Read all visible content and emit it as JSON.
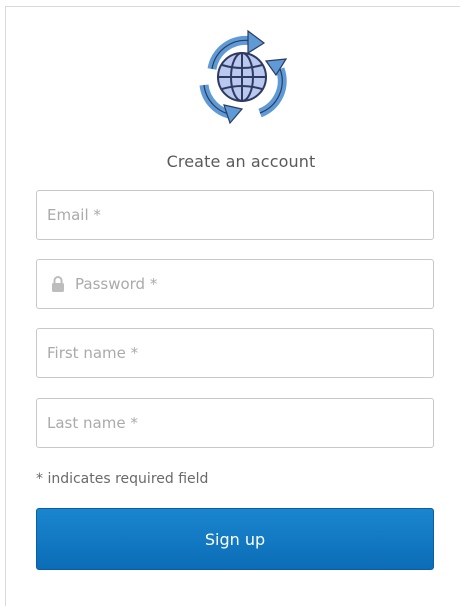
{
  "form": {
    "title": "Create an account",
    "fields": [
      {
        "name": "email",
        "placeholder": "Email *",
        "value": ""
      },
      {
        "name": "password",
        "placeholder": "Password *",
        "value": "",
        "icon": "lock-icon"
      },
      {
        "name": "first_name",
        "placeholder": "First name *",
        "value": ""
      },
      {
        "name": "last_name",
        "placeholder": "Last name *",
        "value": ""
      }
    ],
    "required_hint": "* indicates required field",
    "submit_label": "Sign up"
  },
  "colors": {
    "primary": "#0b6db6",
    "logo_ring": "#6fa8dc",
    "logo_globe": "#b9c8ef",
    "logo_stroke": "#2e3a62"
  },
  "logo": {
    "icon": "globe-refresh-icon"
  }
}
